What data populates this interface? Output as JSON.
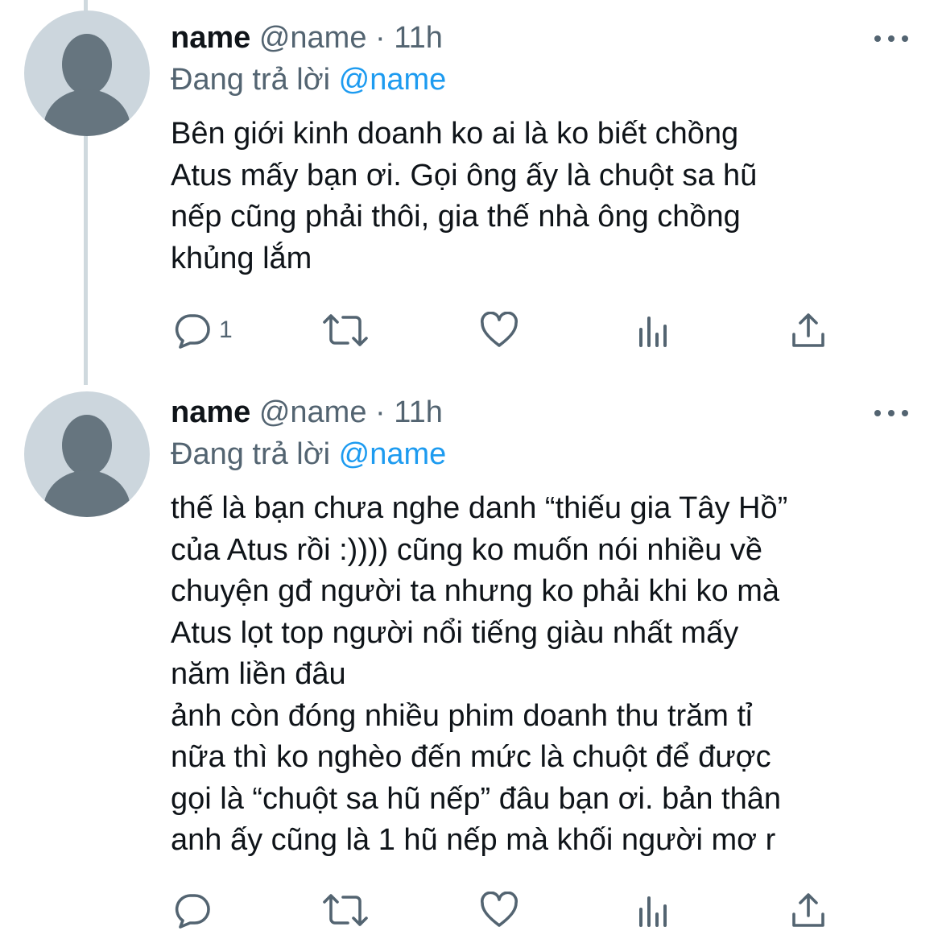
{
  "tweets": [
    {
      "name": "name",
      "handle": "@name",
      "separator": "·",
      "time": "11h",
      "reply_prefix": "Đang trả lời",
      "reply_to": "@name",
      "text": "Bên giới kinh doanh ko ai là ko biết chồng\nAtus mấy bạn ơi. Gọi ông ấy là chuột sa hũ\nnếp cũng phải thôi, gia thế nhà ông chồng\nkhủng lắm",
      "reply_count": "1",
      "icons": [
        "reply-icon",
        "retweet-icon",
        "like-icon",
        "analytics-icon",
        "share-icon",
        "more-icon"
      ]
    },
    {
      "name": "name",
      "handle": "@name",
      "separator": "·",
      "time": "11h",
      "reply_prefix": "Đang trả lời",
      "reply_to": "@name",
      "text": "thế là bạn chưa nghe danh “thiếu gia Tây Hồ”\ncủa Atus rồi :)))) cũng ko muốn nói nhiều về\nchuyện gđ người ta nhưng ko phải khi ko mà\nAtus lọt top người nổi tiếng giàu nhất mấy\nnăm liền đâu\nảnh còn đóng nhiều phim doanh thu trăm tỉ\nnữa thì ko nghèo đến mức là chuột để được\ngọi là “chuột sa hũ nếp” đâu bạn ơi. bản thân\nanh ấy cũng là 1 hũ nếp mà khối người mơ r",
      "reply_count": "",
      "icons": [
        "reply-icon",
        "retweet-icon",
        "like-icon",
        "analytics-icon",
        "share-icon",
        "more-icon"
      ]
    }
  ],
  "colors": {
    "text": "#0f1419",
    "secondary": "#536471",
    "mention": "#1d9bf0",
    "avatar_bg": "#ccd6dd",
    "avatar_fg": "#66757f",
    "thread_line": "#cfd9de"
  }
}
